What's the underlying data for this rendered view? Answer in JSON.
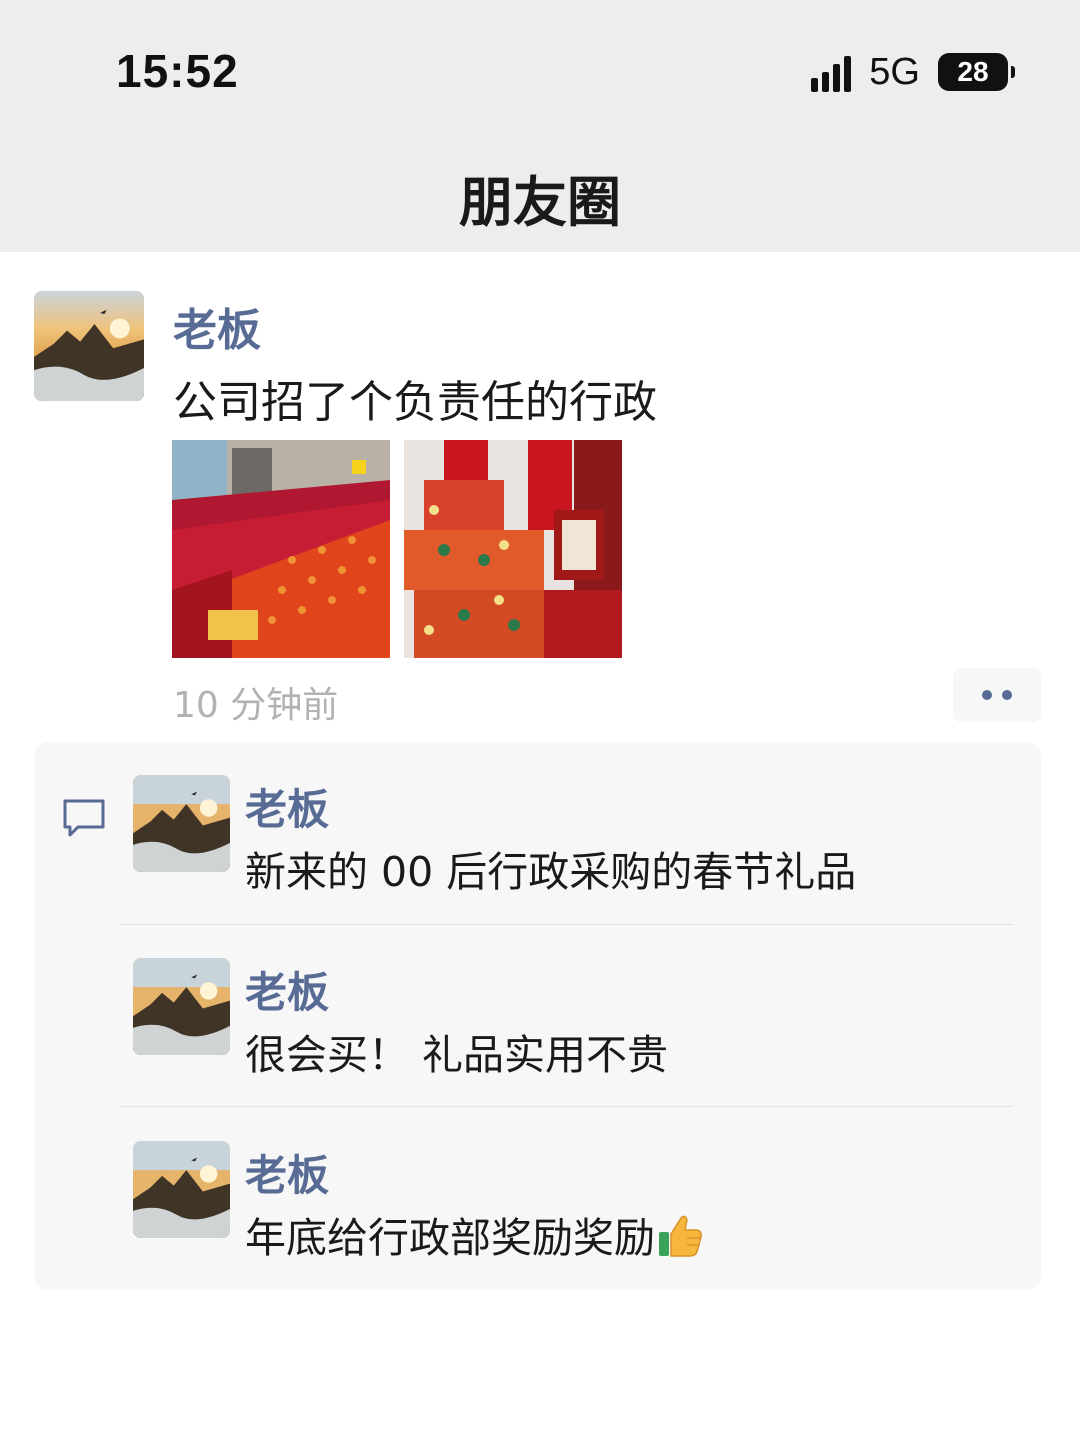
{
  "status_bar": {
    "time": "15:52",
    "network": "5G",
    "battery": "28",
    "signal_icon": "signal-bars-icon"
  },
  "header": {
    "title": "朋友圈"
  },
  "post": {
    "author": "老板",
    "text": "公司招了个负责任的行政",
    "time": "10 分钟前",
    "photos": [
      "photo-1",
      "photo-2"
    ],
    "more_icon": "more-dots-icon"
  },
  "comments": {
    "icon": "comment-bubble-icon",
    "items": [
      {
        "name": "老板",
        "text": "新来的 00 后行政采购的春节礼品"
      },
      {
        "name": "老板",
        "text": "很会买！ 礼品实用不贵"
      },
      {
        "name": "老板",
        "text": "年底给行政部奖励奖励",
        "emoji": "thumbs-up-icon"
      }
    ]
  },
  "colors": {
    "link": "#576b95",
    "header_bg": "#ededed",
    "comment_bg": "#f7f7f7",
    "time_gray": "#b2b2b2"
  }
}
